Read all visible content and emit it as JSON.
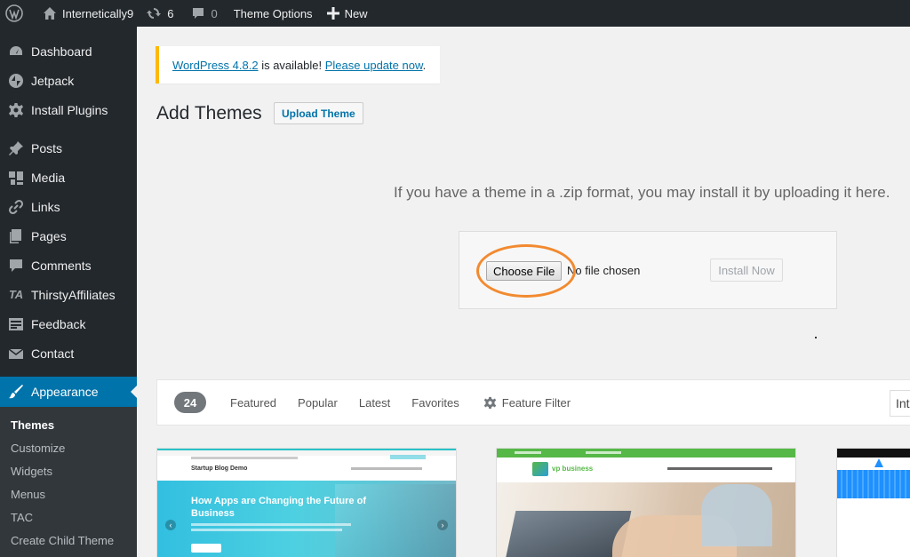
{
  "adminbar": {
    "site_name": "Internetically9",
    "updates_count": "6",
    "comments_count": "0",
    "theme_options": "Theme Options",
    "new_label": "New"
  },
  "sidebar": {
    "items": [
      {
        "label": "Dashboard",
        "icon": "dashboard-icon"
      },
      {
        "label": "Jetpack",
        "icon": "jetpack-icon"
      },
      {
        "label": "Install Plugins",
        "icon": "gear-icon"
      },
      {
        "label": "Posts",
        "icon": "pin-icon"
      },
      {
        "label": "Media",
        "icon": "media-icon"
      },
      {
        "label": "Links",
        "icon": "link-icon"
      },
      {
        "label": "Pages",
        "icon": "pages-icon"
      },
      {
        "label": "Comments",
        "icon": "comment-icon"
      },
      {
        "label": "ThirstyAffiliates",
        "icon": "ta-icon"
      },
      {
        "label": "Feedback",
        "icon": "feedback-icon"
      },
      {
        "label": "Contact",
        "icon": "mail-icon"
      },
      {
        "label": "Appearance",
        "icon": "brush-icon"
      }
    ],
    "submenu": [
      "Themes",
      "Customize",
      "Widgets",
      "Menus",
      "TAC",
      "Create Child Theme"
    ]
  },
  "notice": {
    "link1": "WordPress 4.8.2",
    "middle": " is available! ",
    "link2": "Please update now",
    "end": "."
  },
  "header": {
    "title": "Add Themes",
    "upload_button": "Upload Theme"
  },
  "upload": {
    "instructions": "If you have a theme in a .zip format, you may install it by uploading it here.",
    "choose_file": "Choose File",
    "no_file": "No file chosen",
    "install_now": "Install Now"
  },
  "filter": {
    "count": "24",
    "tabs": [
      "Featured",
      "Popular",
      "Latest",
      "Favorites"
    ],
    "feature_filter": "Feature Filter",
    "search_value": "Inte"
  },
  "themes": {
    "card1": {
      "site_title": "Startup Blog Demo",
      "headline": "How Apps are Changing the Future of Business"
    },
    "card2": {
      "brand": "vp business"
    }
  },
  "colors": {
    "adminbar": "#23282d",
    "accent": "#0073aa",
    "notice_border": "#ffb900",
    "annotation": "#f28a30"
  }
}
